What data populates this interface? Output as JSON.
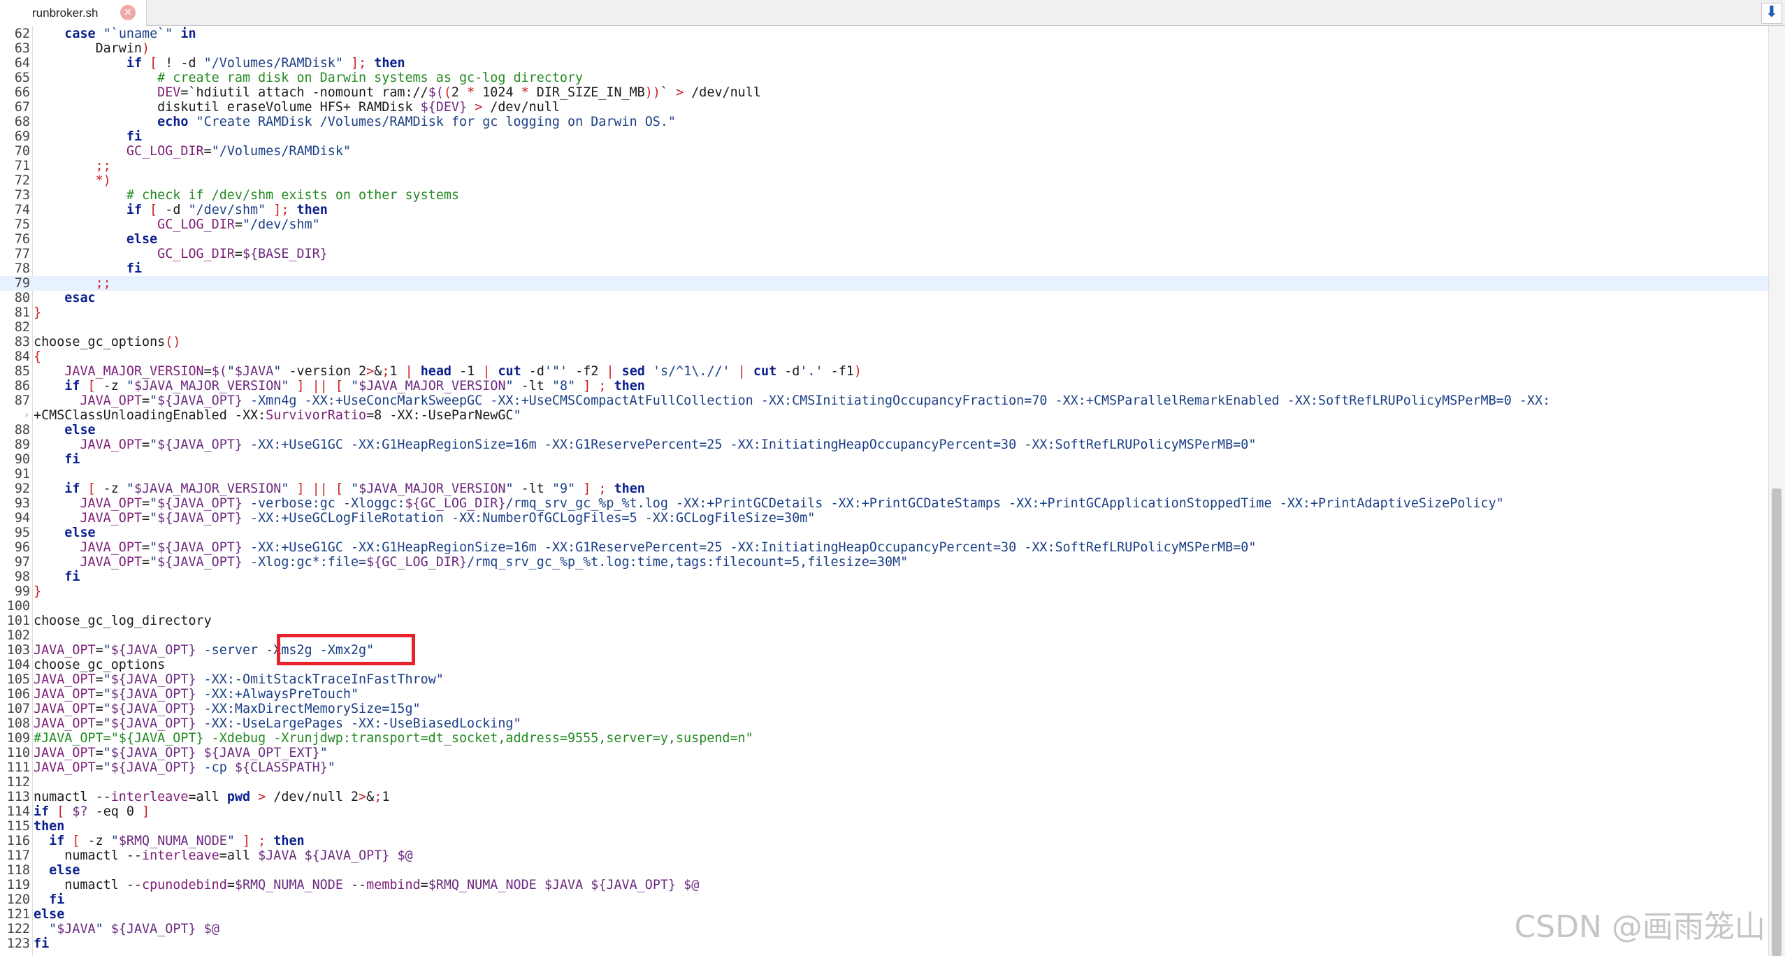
{
  "tab": {
    "label": "runbroker.sh",
    "close_glyph": "✕"
  },
  "scroll_button_glyph": "⬇",
  "watermark": "CSDN @画雨笼山",
  "editor": {
    "current_line": 79,
    "lines": [
      {
        "n": 62,
        "t": "    case \"`uname`\" in"
      },
      {
        "n": 63,
        "t": "        Darwin)"
      },
      {
        "n": 64,
        "t": "            if [ ! -d \"/Volumes/RAMDisk\" ]; then"
      },
      {
        "n": 65,
        "t": "                # create ram disk on Darwin systems as gc-log directory"
      },
      {
        "n": 66,
        "t": "                DEV=`hdiutil attach -nomount ram://$((2 * 1024 * DIR_SIZE_IN_MB))` > /dev/null"
      },
      {
        "n": 67,
        "t": "                diskutil eraseVolume HFS+ RAMDisk ${DEV} > /dev/null"
      },
      {
        "n": 68,
        "t": "                echo \"Create RAMDisk /Volumes/RAMDisk for gc logging on Darwin OS.\""
      },
      {
        "n": 69,
        "t": "            fi"
      },
      {
        "n": 70,
        "t": "            GC_LOG_DIR=\"/Volumes/RAMDisk\""
      },
      {
        "n": 71,
        "t": "        ;;"
      },
      {
        "n": 72,
        "t": "        *)"
      },
      {
        "n": 73,
        "t": "            # check if /dev/shm exists on other systems"
      },
      {
        "n": 74,
        "t": "            if [ -d \"/dev/shm\" ]; then"
      },
      {
        "n": 75,
        "t": "                GC_LOG_DIR=\"/dev/shm\""
      },
      {
        "n": 76,
        "t": "            else"
      },
      {
        "n": 77,
        "t": "                GC_LOG_DIR=${BASE_DIR}"
      },
      {
        "n": 78,
        "t": "            fi"
      },
      {
        "n": 79,
        "t": "        ;;"
      },
      {
        "n": 80,
        "t": "    esac"
      },
      {
        "n": 81,
        "t": "}"
      },
      {
        "n": 82,
        "t": ""
      },
      {
        "n": 83,
        "t": "choose_gc_options()"
      },
      {
        "n": 84,
        "t": "{"
      },
      {
        "n": 85,
        "t": "    JAVA_MAJOR_VERSION=$(\"$JAVA\" -version 2>&1 | head -1 | cut -d'\"' -f2 | sed 's/^1\\.//' | cut -d'.' -f1)"
      },
      {
        "n": 86,
        "t": "    if [ -z \"$JAVA_MAJOR_VERSION\" ] || [ \"$JAVA_MAJOR_VERSION\" -lt \"8\" ] ; then"
      },
      {
        "n": 87,
        "t": "      JAVA_OPT=\"${JAVA_OPT} -Xmn4g -XX:+UseConcMarkSweepGC -XX:+UseCMSCompactAtFullCollection -XX:CMSInitiatingOccupancyFraction=70 -XX:+CMSParallelRemarkEnabled -XX:SoftRefLRUPolicyMSPerMB=0 -XX:"
      },
      {
        "n": null,
        "t": "+CMSClassUnloadingEnabled -XX:SurvivorRatio=8 -XX:-UseParNewGC\""
      },
      {
        "n": 88,
        "t": "    else"
      },
      {
        "n": 89,
        "t": "      JAVA_OPT=\"${JAVA_OPT} -XX:+UseG1GC -XX:G1HeapRegionSize=16m -XX:G1ReservePercent=25 -XX:InitiatingHeapOccupancyPercent=30 -XX:SoftRefLRUPolicyMSPerMB=0\""
      },
      {
        "n": 90,
        "t": "    fi"
      },
      {
        "n": 91,
        "t": ""
      },
      {
        "n": 92,
        "t": "    if [ -z \"$JAVA_MAJOR_VERSION\" ] || [ \"$JAVA_MAJOR_VERSION\" -lt \"9\" ] ; then"
      },
      {
        "n": 93,
        "t": "      JAVA_OPT=\"${JAVA_OPT} -verbose:gc -Xloggc:${GC_LOG_DIR}/rmq_srv_gc_%p_%t.log -XX:+PrintGCDetails -XX:+PrintGCDateStamps -XX:+PrintGCApplicationStoppedTime -XX:+PrintAdaptiveSizePolicy\""
      },
      {
        "n": 94,
        "t": "      JAVA_OPT=\"${JAVA_OPT} -XX:+UseGCLogFileRotation -XX:NumberOfGCLogFiles=5 -XX:GCLogFileSize=30m\""
      },
      {
        "n": 95,
        "t": "    else"
      },
      {
        "n": 96,
        "t": "      JAVA_OPT=\"${JAVA_OPT} -XX:+UseG1GC -XX:G1HeapRegionSize=16m -XX:G1ReservePercent=25 -XX:InitiatingHeapOccupancyPercent=30 -XX:SoftRefLRUPolicyMSPerMB=0\""
      },
      {
        "n": 97,
        "t": "      JAVA_OPT=\"${JAVA_OPT} -Xlog:gc*:file=${GC_LOG_DIR}/rmq_srv_gc_%p_%t.log:time,tags:filecount=5,filesize=30M\""
      },
      {
        "n": 98,
        "t": "    fi"
      },
      {
        "n": 99,
        "t": "}"
      },
      {
        "n": 100,
        "t": ""
      },
      {
        "n": 101,
        "t": "choose_gc_log_directory"
      },
      {
        "n": 102,
        "t": ""
      },
      {
        "n": 103,
        "t": "JAVA_OPT=\"${JAVA_OPT} -server -Xms2g -Xmx2g\""
      },
      {
        "n": 104,
        "t": "choose_gc_options"
      },
      {
        "n": 105,
        "t": "JAVA_OPT=\"${JAVA_OPT} -XX:-OmitStackTraceInFastThrow\""
      },
      {
        "n": 106,
        "t": "JAVA_OPT=\"${JAVA_OPT} -XX:+AlwaysPreTouch\""
      },
      {
        "n": 107,
        "t": "JAVA_OPT=\"${JAVA_OPT} -XX:MaxDirectMemorySize=15g\""
      },
      {
        "n": 108,
        "t": "JAVA_OPT=\"${JAVA_OPT} -XX:-UseLargePages -XX:-UseBiasedLocking\""
      },
      {
        "n": 109,
        "t": "#JAVA_OPT=\"${JAVA_OPT} -Xdebug -Xrunjdwp:transport=dt_socket,address=9555,server=y,suspend=n\""
      },
      {
        "n": 110,
        "t": "JAVA_OPT=\"${JAVA_OPT} ${JAVA_OPT_EXT}\""
      },
      {
        "n": 111,
        "t": "JAVA_OPT=\"${JAVA_OPT} -cp ${CLASSPATH}\""
      },
      {
        "n": 112,
        "t": ""
      },
      {
        "n": 113,
        "t": "numactl --interleave=all pwd > /dev/null 2>&1"
      },
      {
        "n": 114,
        "t": "if [ $? -eq 0 ]"
      },
      {
        "n": 115,
        "t": "then"
      },
      {
        "n": 116,
        "t": "  if [ -z \"$RMQ_NUMA_NODE\" ] ; then"
      },
      {
        "n": 117,
        "t": "    numactl --interleave=all $JAVA ${JAVA_OPT} $@"
      },
      {
        "n": 118,
        "t": "  else"
      },
      {
        "n": 119,
        "t": "    numactl --cpunodebind=$RMQ_NUMA_NODE --membind=$RMQ_NUMA_NODE $JAVA ${JAVA_OPT} $@"
      },
      {
        "n": 120,
        "t": "  fi"
      },
      {
        "n": 121,
        "t": "else"
      },
      {
        "n": 122,
        "t": "  \"$JAVA\" ${JAVA_OPT} $@"
      },
      {
        "n": 123,
        "t": "fi"
      }
    ]
  }
}
